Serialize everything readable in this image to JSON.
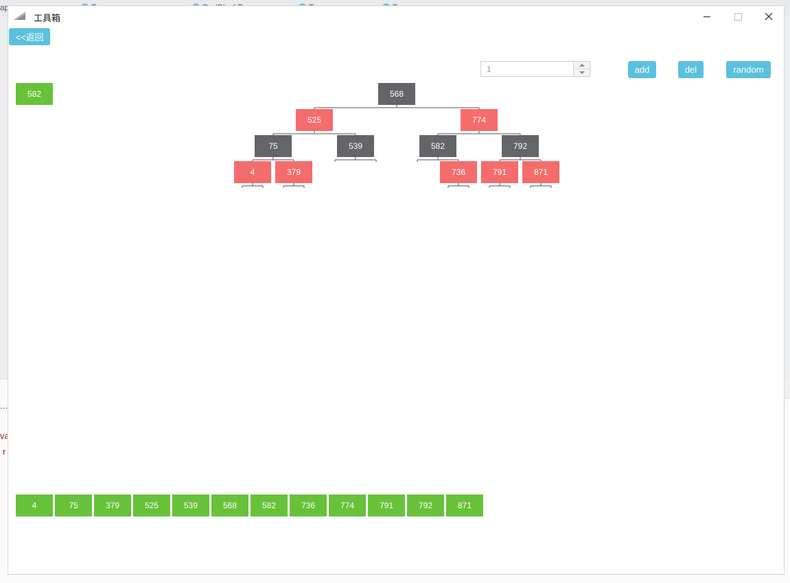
{
  "background": {
    "tabs": [
      {
        "label": "ap"
      },
      {
        "label": "Tr..."
      },
      {
        "label": "RedBlackTree..."
      },
      {
        "label": "Tr..."
      },
      {
        "label": "Tr..."
      }
    ],
    "fragments": [
      "...",
      "va",
      "r"
    ]
  },
  "window": {
    "title": "工具箱",
    "back_label": "<<返回"
  },
  "controls": {
    "stepper_value": "1",
    "add_label": "add",
    "del_label": "del",
    "random_label": "random"
  },
  "current_value": "582",
  "tree": {
    "colors": {
      "black": "#646569",
      "red": "#f56c6c",
      "list": "#67c23a",
      "button": "#5bc0de"
    },
    "nodes": [
      {
        "value": "568",
        "color": "black"
      },
      {
        "value": "525",
        "color": "red"
      },
      {
        "value": "774",
        "color": "red"
      },
      {
        "value": "75",
        "color": "black"
      },
      {
        "value": "539",
        "color": "black"
      },
      {
        "value": "582",
        "color": "black"
      },
      {
        "value": "792",
        "color": "black"
      },
      {
        "value": "4",
        "color": "red"
      },
      {
        "value": "379",
        "color": "red"
      },
      {
        "value": "736",
        "color": "red"
      },
      {
        "value": "791",
        "color": "red"
      },
      {
        "value": "871",
        "color": "red"
      }
    ]
  },
  "sorted_list": [
    "4",
    "75",
    "379",
    "525",
    "539",
    "568",
    "582",
    "736",
    "774",
    "791",
    "792",
    "871"
  ]
}
